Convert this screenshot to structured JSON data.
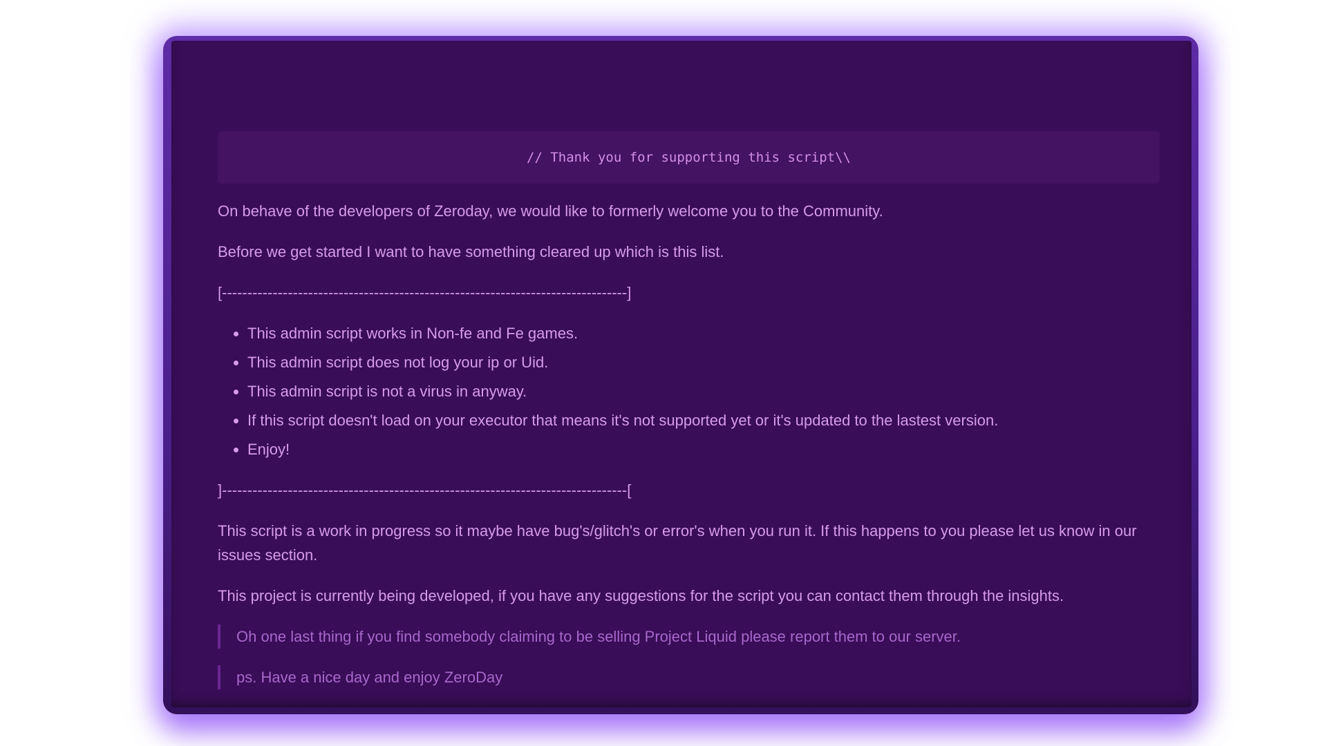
{
  "code_line": "// Thank you for supporting this script\\\\",
  "paragraphs": {
    "welcome": "On behave of the developers of Zeroday, we would like to formerly welcome you to the Community.",
    "intro": "Before we get started I want to have something cleared up which is this list.",
    "wip": "This script is a work in progress so it maybe have bug's/glitch's or error's when you run it. If this happens to you please let us know in our issues section.",
    "project": "This project is currently being developed, if you have any suggestions for the script you can contact them through the insights."
  },
  "separators": {
    "top": "[--------------------------------------------------------------------------------]",
    "bottom": "]--------------------------------------------------------------------------------["
  },
  "list_items": [
    "This admin script works in Non-fe and Fe games.",
    "This admin script does not log your ip or Uid.",
    "This admin script is not a virus in anyway.",
    "If this script doesn't load on your executor that means it's not supported yet or it's updated to the lastest version.",
    "Enjoy!"
  ],
  "quotes": [
    "Oh one last thing if you find somebody claiming to be selling Project Liquid please report them to our server.",
    "ps. Have a nice day and enjoy ZeroDay"
  ],
  "colors": {
    "frame": "#5e2ca6",
    "background": "#390d57",
    "code_background": "#441361",
    "text": "#d79be9",
    "quote_text": "#a867cd",
    "quote_border": "#6b2593"
  }
}
